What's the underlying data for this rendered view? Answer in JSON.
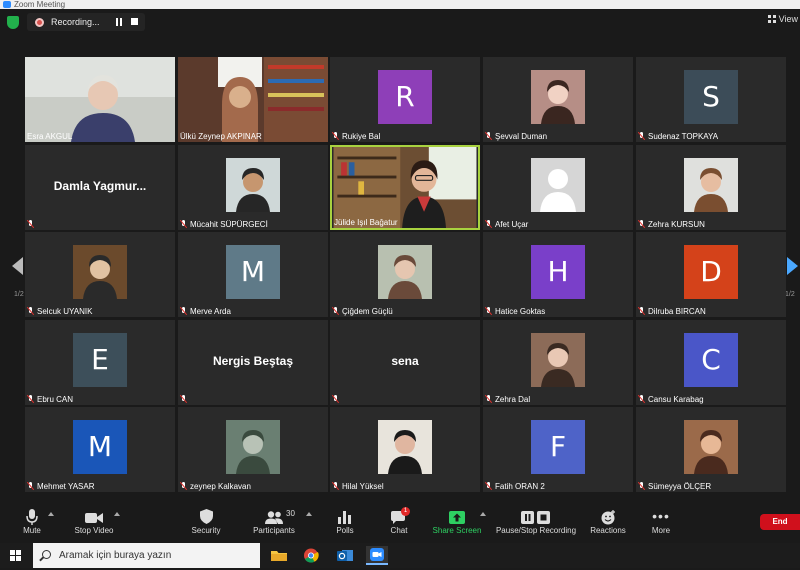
{
  "window": {
    "title": "Zoom Meeting"
  },
  "recording": {
    "label": "Recording..."
  },
  "view": {
    "label": "View"
  },
  "pages": {
    "left": "1/2",
    "right": "1/2"
  },
  "participants": [
    {
      "name": "Esra AKGUL",
      "type": "video",
      "muted": false
    },
    {
      "name": "Ülkü Zeynep AKPINAR",
      "type": "video",
      "muted": false
    },
    {
      "name": "Rukiye Bal",
      "type": "avatar",
      "initial": "R",
      "color": "#8e3fb8",
      "muted": true
    },
    {
      "name": "Şevval Duman",
      "type": "photo",
      "muted": true
    },
    {
      "name": "Sudenaz TOPKAYA",
      "type": "avatar",
      "initial": "S",
      "color": "#3c4c58",
      "muted": true
    },
    {
      "name": "",
      "type": "name",
      "display": "Damla  Yagmur...",
      "muted": true
    },
    {
      "name": "Mücahit SÜPÜRGECİ",
      "type": "photo",
      "muted": true
    },
    {
      "name": "Jülide Işıl Bağatur",
      "type": "video",
      "muted": false,
      "active": true
    },
    {
      "name": "Afet Uçar",
      "type": "default",
      "muted": true
    },
    {
      "name": "Zehra KURSUN",
      "type": "photo",
      "muted": true
    },
    {
      "name": "Selcuk UYANIK",
      "type": "photo",
      "muted": true
    },
    {
      "name": "Merve Arda",
      "type": "avatar",
      "initial": "M",
      "color": "#5f7a88",
      "muted": true
    },
    {
      "name": "Çiğdem Güçlü",
      "type": "photo",
      "muted": true
    },
    {
      "name": "Hatice Goktas",
      "type": "avatar",
      "initial": "H",
      "color": "#7a3fc9",
      "muted": true
    },
    {
      "name": "Dilruba BIRCAN",
      "type": "avatar",
      "initial": "D",
      "color": "#d4421a",
      "muted": true
    },
    {
      "name": "Ebru CAN",
      "type": "avatar",
      "initial": "E",
      "color": "#3d4f5a",
      "muted": true
    },
    {
      "name": "",
      "type": "name",
      "display": "Nergis Beştaş",
      "muted": true
    },
    {
      "name": "",
      "type": "name",
      "display": "sena",
      "muted": true
    },
    {
      "name": "Zehra Dal",
      "type": "photo",
      "muted": true
    },
    {
      "name": "Cansu Karabag",
      "type": "avatar",
      "initial": "C",
      "color": "#4a56c8",
      "muted": true
    },
    {
      "name": "Mehmet YASAR",
      "type": "avatar",
      "initial": "M",
      "color": "#1a56b8",
      "muted": true
    },
    {
      "name": "zeynep Kalkavan",
      "type": "photo",
      "muted": true
    },
    {
      "name": "Hilal Yüksel",
      "type": "photo",
      "muted": true
    },
    {
      "name": "Fatih ORAN 2",
      "type": "avatar",
      "initial": "F",
      "color": "#4e63c8",
      "muted": true
    },
    {
      "name": "Sümeyya ÖLÇER",
      "type": "photo",
      "muted": true
    }
  ],
  "toolbar": {
    "mute": "Mute",
    "stop_video": "Stop Video",
    "security": "Security",
    "participants": "Participants",
    "participants_count": "30",
    "polls": "Polls",
    "chat": "Chat",
    "chat_badge": "1",
    "share_screen": "Share Screen",
    "pause_stop_recording": "Pause/Stop Recording",
    "reactions": "Reactions",
    "more": "More",
    "end": "End"
  },
  "taskbar": {
    "search_placeholder": "Aramak için buraya yazın"
  },
  "colors": {
    "accent_green": "#2ed062",
    "end_red": "#d0101c",
    "active_border": "#a8d23f",
    "zoom_blue": "#2d8cff"
  }
}
